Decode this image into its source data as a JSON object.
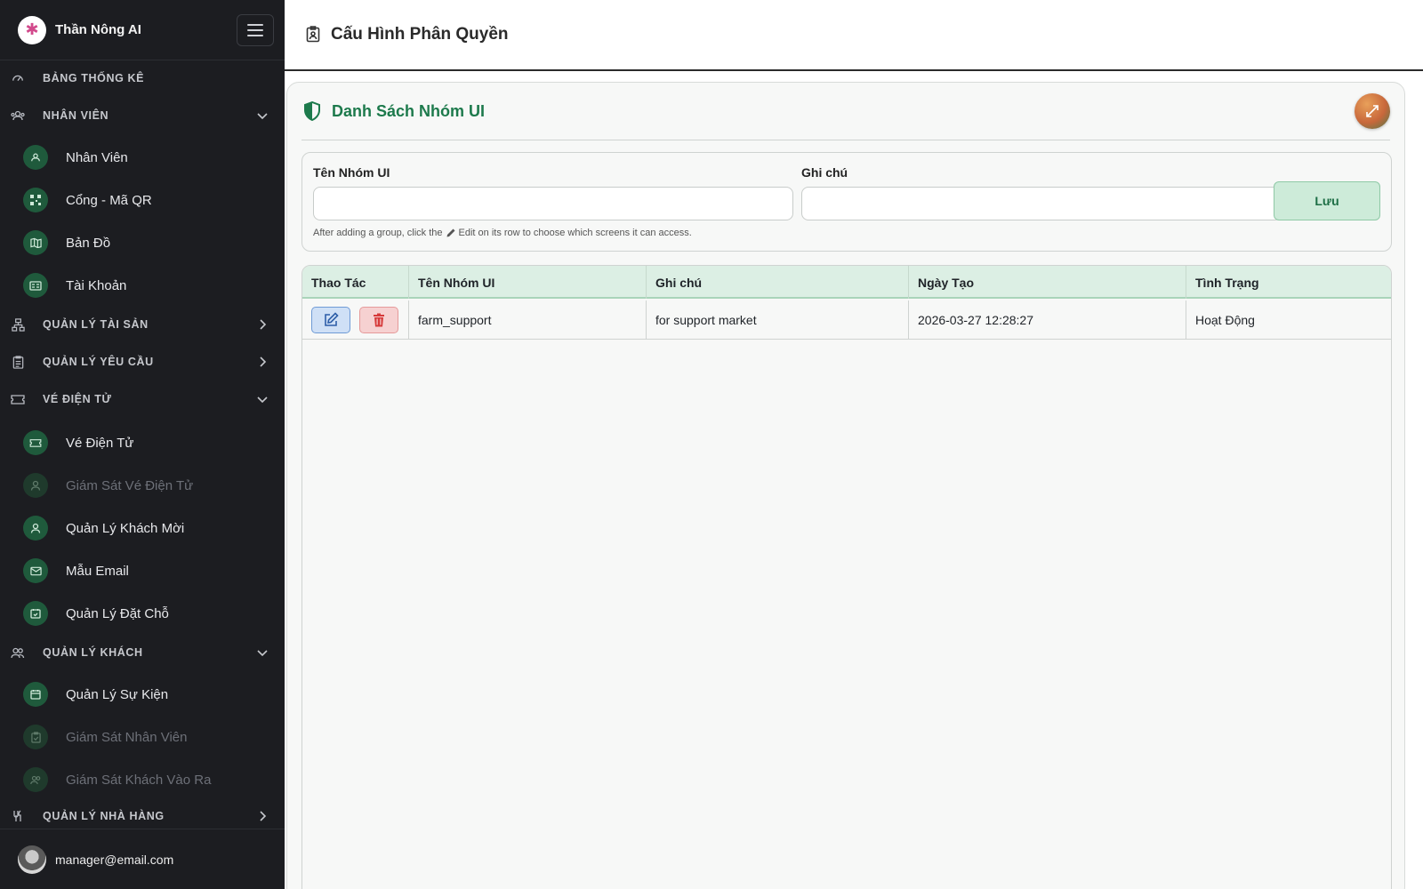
{
  "brand": {
    "name": "Thần Nông AI"
  },
  "sidebar": {
    "sections": [
      {
        "label": "BẢNG THỐNG KÊ",
        "icon": "dashboard-icon"
      },
      {
        "label": "NHÂN VIÊN",
        "icon": "team-icon",
        "expanded": true
      },
      {
        "label": "QUẢN LÝ TÀI SẢN",
        "icon": "sitemap-icon",
        "expanded": false
      },
      {
        "label": "QUẢN LÝ YÊU CẦU",
        "icon": "clipboard-icon",
        "expanded": false
      },
      {
        "label": "VÉ ĐIỆN TỬ",
        "icon": "ticket-icon",
        "expanded": true
      },
      {
        "label": "QUẢN LÝ KHÁCH",
        "icon": "users-icon",
        "expanded": true
      },
      {
        "label": "QUẢN LÝ NHÀ HÀNG",
        "icon": "cutlery-icon",
        "expanded": false
      }
    ],
    "items": [
      {
        "label": "Nhân Viên",
        "icon": "team-icon"
      },
      {
        "label": "Cổng - Mã QR",
        "icon": "qr-icon"
      },
      {
        "label": "Bản Đồ",
        "icon": "map-icon"
      },
      {
        "label": "Tài Khoản",
        "icon": "id-card-icon"
      },
      {
        "label": "Vé Điện Tử",
        "icon": "ticket-icon"
      },
      {
        "label": "Giám Sát Vé Điện Tử",
        "icon": "user-monitor-icon",
        "disabled": true
      },
      {
        "label": "Quản Lý Khách Mời",
        "icon": "user-icon"
      },
      {
        "label": "Mẫu Email",
        "icon": "mail-icon"
      },
      {
        "label": "Quản Lý Đặt Chỗ",
        "icon": "calendar-check-icon"
      },
      {
        "label": "Quản Lý Sự Kiện",
        "icon": "calendar-icon"
      },
      {
        "label": "Giám Sát Nhân Viên",
        "icon": "clipboard-check-icon",
        "disabled": true
      },
      {
        "label": "Giám Sát Khách Vào Ra",
        "icon": "users-icon",
        "disabled": true
      }
    ]
  },
  "user": {
    "email": "manager@email.com"
  },
  "header": {
    "title": "Cấu Hình Phân Quyền"
  },
  "card": {
    "title": "Danh Sách Nhóm UI",
    "form": {
      "name_label": "Tên Nhóm UI",
      "name_value": "",
      "note_label": "Ghi chú",
      "note_value": "",
      "save_label": "Lưu",
      "hint_before": "After adding a group, click the",
      "hint_after": "Edit on its row to choose which screens it can access."
    }
  },
  "table": {
    "columns": [
      "Thao Tác",
      "Tên Nhóm UI",
      "Ghi chú",
      "Ngày Tạo",
      "Tình Trạng"
    ],
    "rows": [
      {
        "name": "farm_support",
        "note": "for support market",
        "created": "2026-03-27 12:28:27",
        "status": "Hoạt Động"
      }
    ]
  },
  "colors": {
    "accent": "#1d7a4c",
    "sidebar_bg": "#1c1d21",
    "table_header": "#dcefe4"
  }
}
